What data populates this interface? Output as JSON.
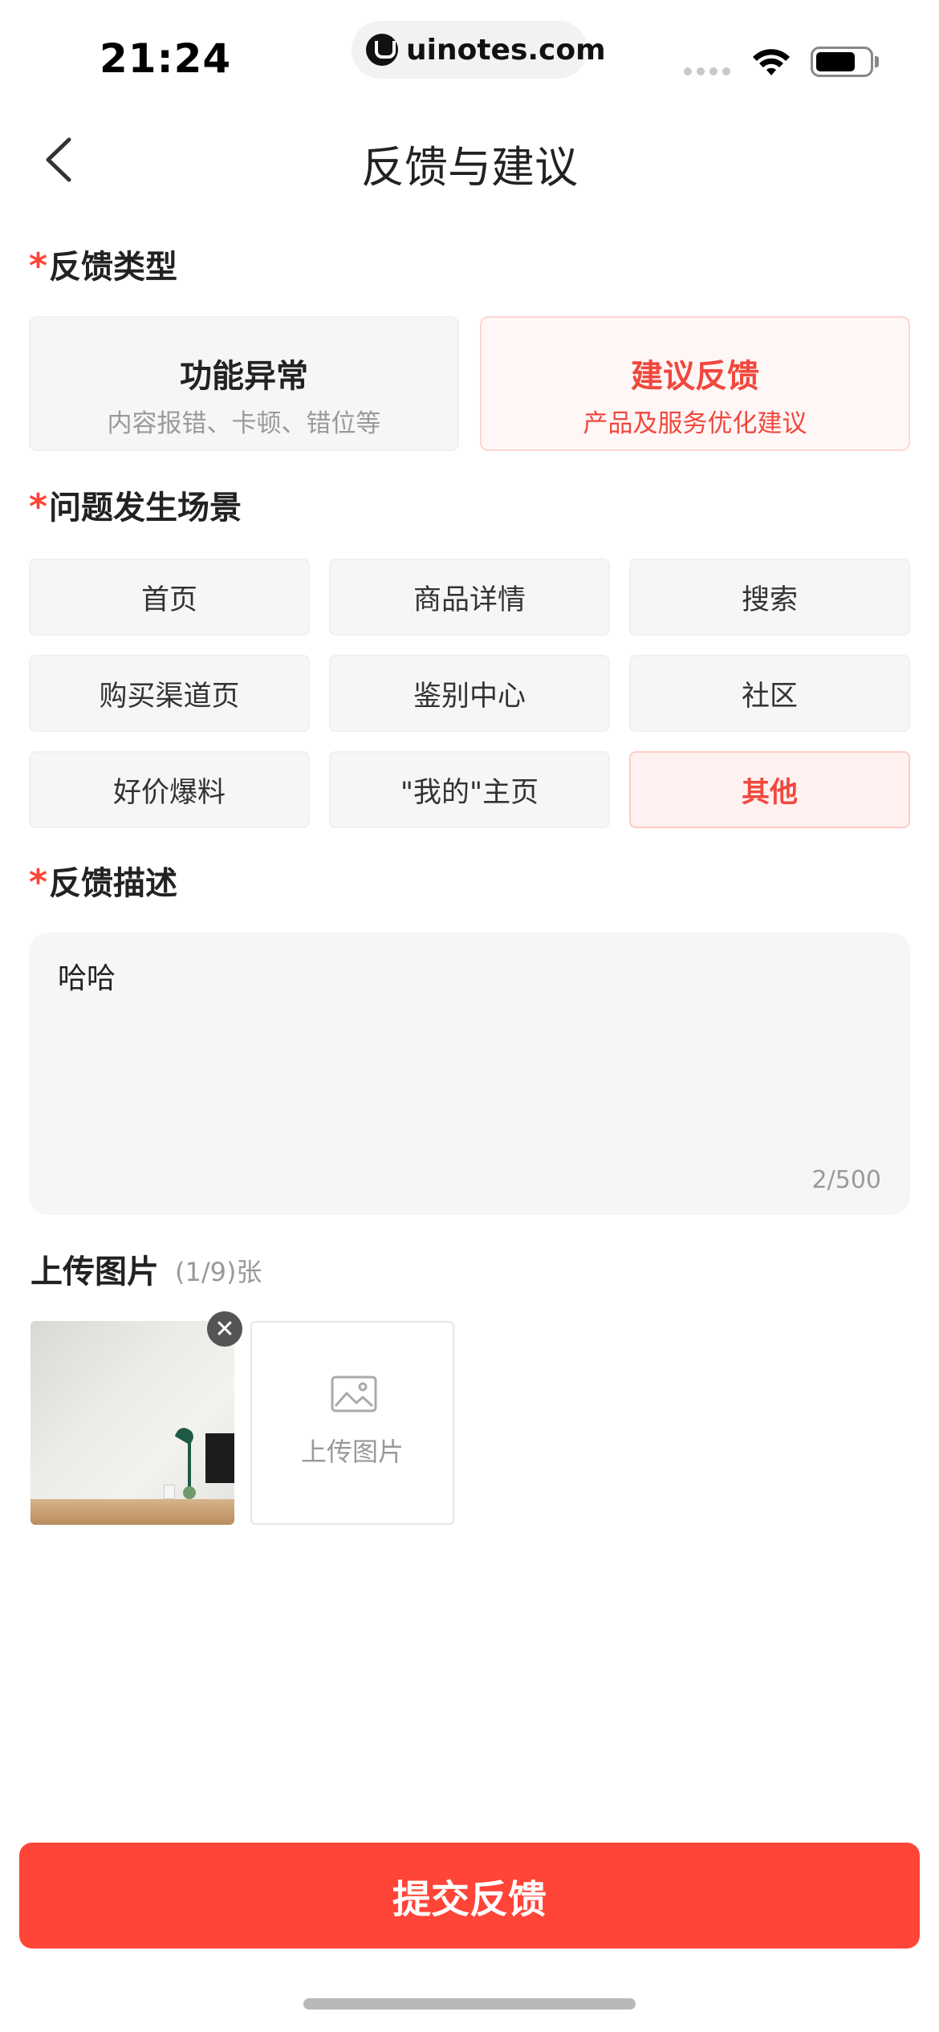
{
  "status_bar": {
    "time": "21:24",
    "site": "uinotes.com",
    "icons": [
      "signal-icon",
      "wifi-icon",
      "battery-icon"
    ]
  },
  "header": {
    "title": "反馈与建议",
    "back_icon": "chevron-left-icon"
  },
  "required_mark": "*",
  "feedback_type": {
    "label": "反馈类型",
    "options": [
      {
        "title": "功能异常",
        "subtitle": "内容报错、卡顿、错位等",
        "selected": false
      },
      {
        "title": "建议反馈",
        "subtitle": "产品及服务优化建议",
        "selected": true
      }
    ]
  },
  "scene": {
    "label": "问题发生场景",
    "options": [
      {
        "label": "首页",
        "selected": false
      },
      {
        "label": "商品详情",
        "selected": false
      },
      {
        "label": "搜索",
        "selected": false
      },
      {
        "label": "购买渠道页",
        "selected": false
      },
      {
        "label": "鉴别中心",
        "selected": false
      },
      {
        "label": "社区",
        "selected": false
      },
      {
        "label": "好价爆料",
        "selected": false
      },
      {
        "label": "\"我的\"主页",
        "selected": false
      },
      {
        "label": "其他",
        "selected": true
      }
    ]
  },
  "description": {
    "label": "反馈描述",
    "value": "哈哈",
    "counter": "2/500"
  },
  "upload": {
    "label": "上传图片",
    "count": "(1/9)张",
    "add_label": "上传图片",
    "remove_icon": "close-icon",
    "add_icon": "image-icon"
  },
  "submit": {
    "label": "提交反馈"
  },
  "colors": {
    "accent": "#ff4438",
    "accent_text": "#f0483e",
    "card_bg": "#f6f6f8"
  }
}
